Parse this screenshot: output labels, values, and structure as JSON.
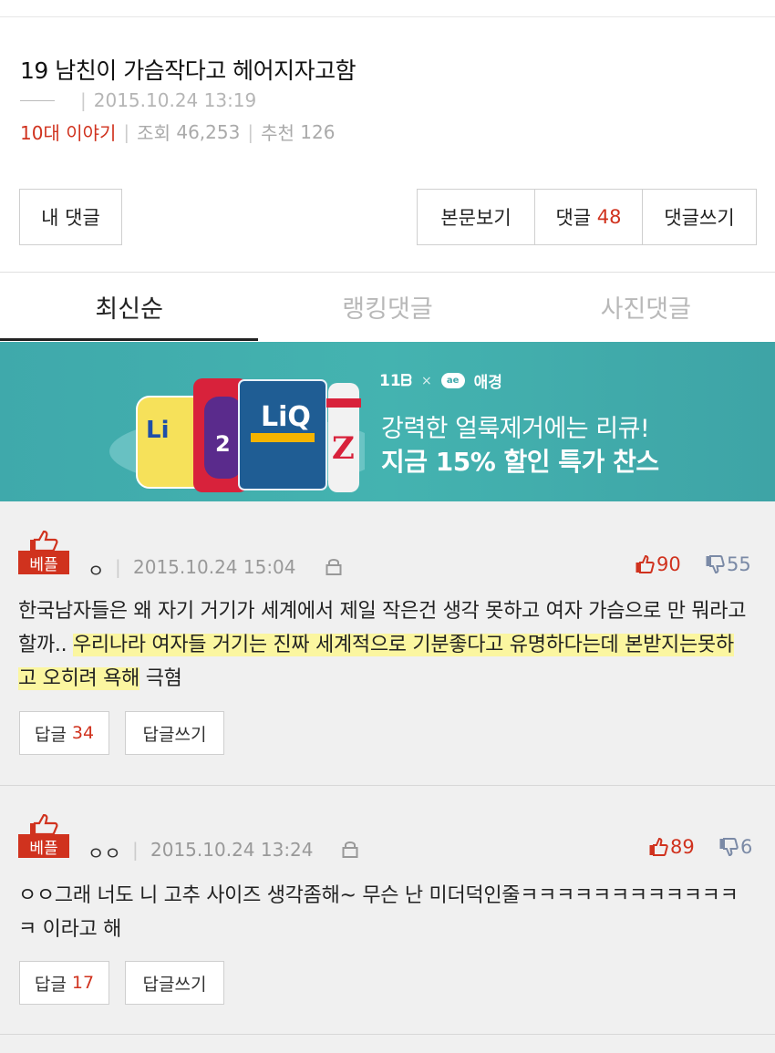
{
  "post": {
    "title": "19 남친이 가슴작다고 헤어지자고함",
    "date": "2015.10.24 13:19",
    "category": "10대 이야기",
    "views_label": "조회",
    "views": "46,253",
    "recommend_label": "추천",
    "recommend": "126"
  },
  "actions": {
    "my_comments": "내 댓글",
    "view_body": "본문보기",
    "comments_label": "댓글",
    "comments_count": "48",
    "write_comment": "댓글쓰기"
  },
  "tabs": [
    {
      "label": "최신순",
      "active": true
    },
    {
      "label": "랭킹댓글",
      "active": false
    },
    {
      "label": "사진댓글",
      "active": false
    }
  ],
  "banner": {
    "logo_11st": "11ᗷ",
    "logo_sep": "×",
    "logo_ae_mark": "ae",
    "logo_ae": "애경",
    "line1": "강력한 얼룩제거에는 리큐!",
    "line2": "지금 15% 할인 특가 찬스"
  },
  "comments": [
    {
      "badge": "베플",
      "author": "ㅇ",
      "date": "2015.10.24 15:04",
      "up": "90",
      "down": "55",
      "text_a": "한국남자들은 왜 자기 거기가 세계에서 제일 작은건 생각 못하고 여자 가슴으로 만 뭐라고할까.. ",
      "text_hl": "우리나라 여자들 거기는 진짜 세계적으로 기분좋다고 유명하다는데 본받지는못하고 오히려 욕해",
      "text_b": " 극혐",
      "reply_label": "답글",
      "reply_count": "34",
      "write_reply": "답글쓰기"
    },
    {
      "badge": "베플",
      "author": "ㅇㅇ",
      "date": "2015.10.24 13:24",
      "up": "89",
      "down": "6",
      "text": "ㅇㅇ그래 너도 니 고추 사이즈 생각좀해~ 무슨 난 미더덕인줄ㅋㅋㅋㅋㅋㅋㅋㅋㅋㅋㅋㅋㅋ 이라고 해",
      "reply_label": "답글",
      "reply_count": "17",
      "write_reply": "답글쓰기"
    }
  ],
  "colors": {
    "accent": "#d0321e",
    "banner": "#42ADAD",
    "highlight": "#fbf6a0",
    "downvote": "#7b8aa6"
  }
}
